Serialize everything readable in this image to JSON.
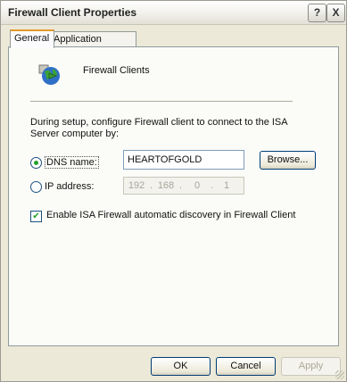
{
  "window": {
    "title": "Firewall Client Properties",
    "help_glyph": "?",
    "close_glyph": "X"
  },
  "tabs": [
    {
      "label": "General",
      "selected": true
    },
    {
      "label": "Application Settings",
      "selected": false
    }
  ],
  "general": {
    "header_label": "Firewall Clients",
    "description": "During setup, configure Firewall client to connect to the ISA Server computer by:",
    "dns_option": {
      "label": "DNS name:",
      "checked": true
    },
    "dns_value": "HEARTOFGOLD",
    "browse_label": "Browse...",
    "ip_option": {
      "label": "IP address:",
      "checked": false
    },
    "ip_octets": [
      "192",
      "168",
      "0",
      "1"
    ],
    "auto_discovery": {
      "label": "Enable ISA Firewall automatic discovery in Firewall Client",
      "checked": true
    }
  },
  "footer": {
    "ok_label": "OK",
    "cancel_label": "Cancel",
    "apply_label": "Apply"
  },
  "icons": {
    "header_icon": "firewall-client-globe-icon",
    "check_glyph": "✔"
  },
  "colors": {
    "accent_tab": "#e59a2d",
    "radio_dot": "#24a12c"
  }
}
